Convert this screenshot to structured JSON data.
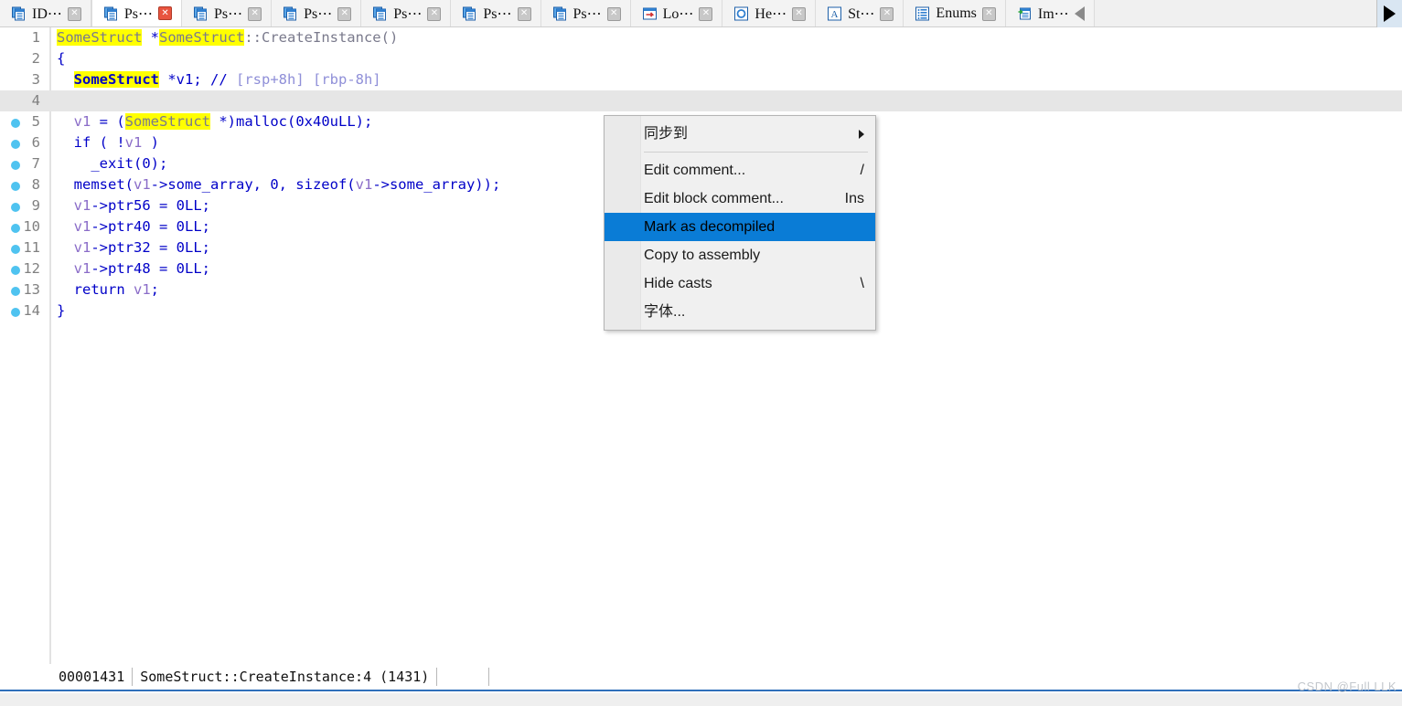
{
  "tabbar": {
    "tabs": [
      {
        "label": "ID⋯",
        "icon": "document-list-icon",
        "active": false,
        "closable": true
      },
      {
        "label": "Ps⋯",
        "icon": "document-list-icon",
        "active": true,
        "closable": true
      },
      {
        "label": "Ps⋯",
        "icon": "document-list-icon",
        "active": false,
        "closable": true
      },
      {
        "label": "Ps⋯",
        "icon": "document-list-icon",
        "active": false,
        "closable": true
      },
      {
        "label": "Ps⋯",
        "icon": "document-list-icon",
        "active": false,
        "closable": true
      },
      {
        "label": "Ps⋯",
        "icon": "document-list-icon",
        "active": false,
        "closable": true
      },
      {
        "label": "Ps⋯",
        "icon": "document-list-icon",
        "active": false,
        "closable": true
      },
      {
        "label": "Lo⋯",
        "icon": "log-window-icon",
        "active": false,
        "closable": true
      },
      {
        "label": "He⋯",
        "icon": "hex-view-icon",
        "active": false,
        "closable": true
      },
      {
        "label": "St⋯",
        "icon": "strings-window-icon",
        "active": false,
        "closable": true
      },
      {
        "label": "Enums",
        "icon": "enums-window-icon",
        "active": false,
        "closable": true
      },
      {
        "label": "Im⋯",
        "icon": "imports-window-icon",
        "active": false,
        "closable": false
      }
    ],
    "scroll_left_icon": "triangle-left-icon",
    "scroll_right_icon": "triangle-right-icon"
  },
  "editor": {
    "current_line": 4,
    "lines": [
      {
        "n": "1",
        "bullet": false,
        "current": false,
        "tokens": [
          {
            "t": "SomeStruct",
            "c": "t-type",
            "hl": true
          },
          {
            "t": " *",
            "c": "t-kw"
          },
          {
            "t": "SomeStruct",
            "c": "t-type",
            "hl": true
          },
          {
            "t": "::CreateInstance()",
            "c": "t-type"
          }
        ]
      },
      {
        "n": "2",
        "bullet": false,
        "current": false,
        "tokens": [
          {
            "t": "{",
            "c": "t-kw"
          }
        ]
      },
      {
        "n": "3",
        "bullet": false,
        "current": false,
        "tokens": [
          {
            "t": "  ",
            "c": "t-plain"
          },
          {
            "t": "SomeStruct",
            "c": "t-kw",
            "hl": true,
            "b": true
          },
          {
            "t": " *v1; // ",
            "c": "t-kw"
          },
          {
            "t": "[rsp+8h] [rbp-8h]",
            "c": "t-cmt"
          }
        ]
      },
      {
        "n": "4",
        "bullet": false,
        "current": true,
        "tokens": []
      },
      {
        "n": "5",
        "bullet": true,
        "current": false,
        "tokens": [
          {
            "t": "  ",
            "c": "t-plain"
          },
          {
            "t": "v1",
            "c": "t-var"
          },
          {
            "t": " = (",
            "c": "t-kw"
          },
          {
            "t": "SomeStruct",
            "c": "t-type",
            "hl": true
          },
          {
            "t": " *)",
            "c": "t-kw"
          },
          {
            "t": "malloc(",
            "c": "t-kw"
          },
          {
            "t": "0x40uLL",
            "c": "t-num"
          },
          {
            "t": ");",
            "c": "t-kw"
          }
        ]
      },
      {
        "n": "6",
        "bullet": true,
        "current": false,
        "tokens": [
          {
            "t": "  ",
            "c": "t-plain"
          },
          {
            "t": "if ( !",
            "c": "t-kw"
          },
          {
            "t": "v1",
            "c": "t-var"
          },
          {
            "t": " )",
            "c": "t-kw"
          }
        ]
      },
      {
        "n": "7",
        "bullet": true,
        "current": false,
        "tokens": [
          {
            "t": "    _exit(0);",
            "c": "t-kw"
          }
        ]
      },
      {
        "n": "8",
        "bullet": true,
        "current": false,
        "tokens": [
          {
            "t": "  ",
            "c": "t-plain"
          },
          {
            "t": "memset(",
            "c": "t-kw"
          },
          {
            "t": "v1",
            "c": "t-var"
          },
          {
            "t": "->some_array, 0, sizeof(",
            "c": "t-kw"
          },
          {
            "t": "v1",
            "c": "t-var"
          },
          {
            "t": "->some_array));",
            "c": "t-kw"
          }
        ]
      },
      {
        "n": "9",
        "bullet": true,
        "current": false,
        "tokens": [
          {
            "t": "  ",
            "c": "t-plain"
          },
          {
            "t": "v1",
            "c": "t-var"
          },
          {
            "t": "->ptr56 = 0LL;",
            "c": "t-kw"
          }
        ]
      },
      {
        "n": "10",
        "bullet": true,
        "current": false,
        "tokens": [
          {
            "t": "  ",
            "c": "t-plain"
          },
          {
            "t": "v1",
            "c": "t-var"
          },
          {
            "t": "->ptr40 = 0LL;",
            "c": "t-kw"
          }
        ]
      },
      {
        "n": "11",
        "bullet": true,
        "current": false,
        "tokens": [
          {
            "t": "  ",
            "c": "t-plain"
          },
          {
            "t": "v1",
            "c": "t-var"
          },
          {
            "t": "->ptr32 = 0LL;",
            "c": "t-kw"
          }
        ]
      },
      {
        "n": "12",
        "bullet": true,
        "current": false,
        "tokens": [
          {
            "t": "  ",
            "c": "t-plain"
          },
          {
            "t": "v1",
            "c": "t-var"
          },
          {
            "t": "->ptr48 = 0LL;",
            "c": "t-kw"
          }
        ]
      },
      {
        "n": "13",
        "bullet": true,
        "current": false,
        "tokens": [
          {
            "t": "  ",
            "c": "t-plain"
          },
          {
            "t": "return ",
            "c": "t-kw"
          },
          {
            "t": "v1",
            "c": "t-var"
          },
          {
            "t": ";",
            "c": "t-kw"
          }
        ]
      },
      {
        "n": "14",
        "bullet": true,
        "current": false,
        "tokens": [
          {
            "t": "}",
            "c": "t-kw"
          }
        ]
      }
    ]
  },
  "context_menu": {
    "items": [
      {
        "label": "同步到",
        "accel": "",
        "submenu": true,
        "selected": false,
        "sep_after": true
      },
      {
        "label": "Edit comment...",
        "accel": "/",
        "submenu": false,
        "selected": false,
        "sep_after": false
      },
      {
        "label": "Edit block comment...",
        "accel": "Ins",
        "submenu": false,
        "selected": false,
        "sep_after": false
      },
      {
        "label": "Mark as decompiled",
        "accel": "",
        "submenu": false,
        "selected": true,
        "sep_after": false
      },
      {
        "label": "Copy to assembly",
        "accel": "",
        "submenu": false,
        "selected": false,
        "sep_after": false
      },
      {
        "label": "Hide casts",
        "accel": "\\",
        "submenu": false,
        "selected": false,
        "sep_after": false
      },
      {
        "label": "字体...",
        "accel": "",
        "submenu": false,
        "selected": false,
        "sep_after": false
      }
    ],
    "highlight_color": "#0a7cd6"
  },
  "statusbar": {
    "address": "00001431",
    "location": "SomeStruct::CreateInstance:4 (1431)",
    "accent_color": "#2f6fba"
  },
  "watermark": {
    "text": "CSDN @Full LLK"
  }
}
